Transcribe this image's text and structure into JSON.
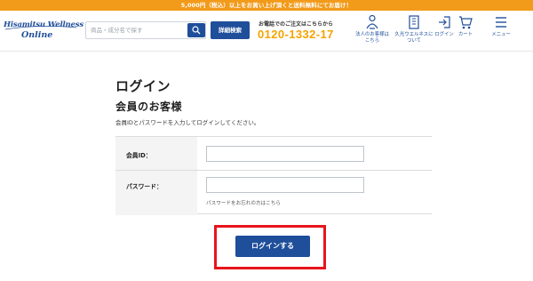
{
  "promo": {
    "text": "5,000円（税込）以上をお買い上げ頂くと送料無料にてお届け！"
  },
  "header": {
    "logo": {
      "brand": "Hisamitsu Wellness",
      "sub": "Online"
    },
    "search": {
      "placeholder": "商品・成分名で探す"
    },
    "detail_search_label": "詳細検索",
    "phone": {
      "label": "お電話でのご注文はこちらから",
      "number": "0120-1332-17"
    },
    "nav": [
      {
        "label": "法人のお客様は\nこちら",
        "icon": "person-icon"
      },
      {
        "label": "久光ウエルネスに\nついて",
        "icon": "building-icon"
      },
      {
        "label": "ログイン",
        "icon": "login-icon"
      },
      {
        "label": "カート",
        "icon": "cart-icon"
      },
      {
        "label": "メニュー",
        "icon": "menu-icon"
      }
    ],
    "accent_color": "#1f4e9a",
    "phone_color": "#f5a300",
    "promo_color": "#f29a1a"
  },
  "main": {
    "page_title": "ログイン",
    "section_title": "会員のお客様",
    "description": "会員IDとパスワードを入力してログインしてください。",
    "form": {
      "member_id_label": "会員ID：",
      "member_id_value": "",
      "password_label": "パスワード：",
      "password_value": "",
      "forgot_text": "パスワードをお忘れの方はこちら"
    },
    "login_button": "ログインする",
    "highlight_color": "#e8141b"
  }
}
